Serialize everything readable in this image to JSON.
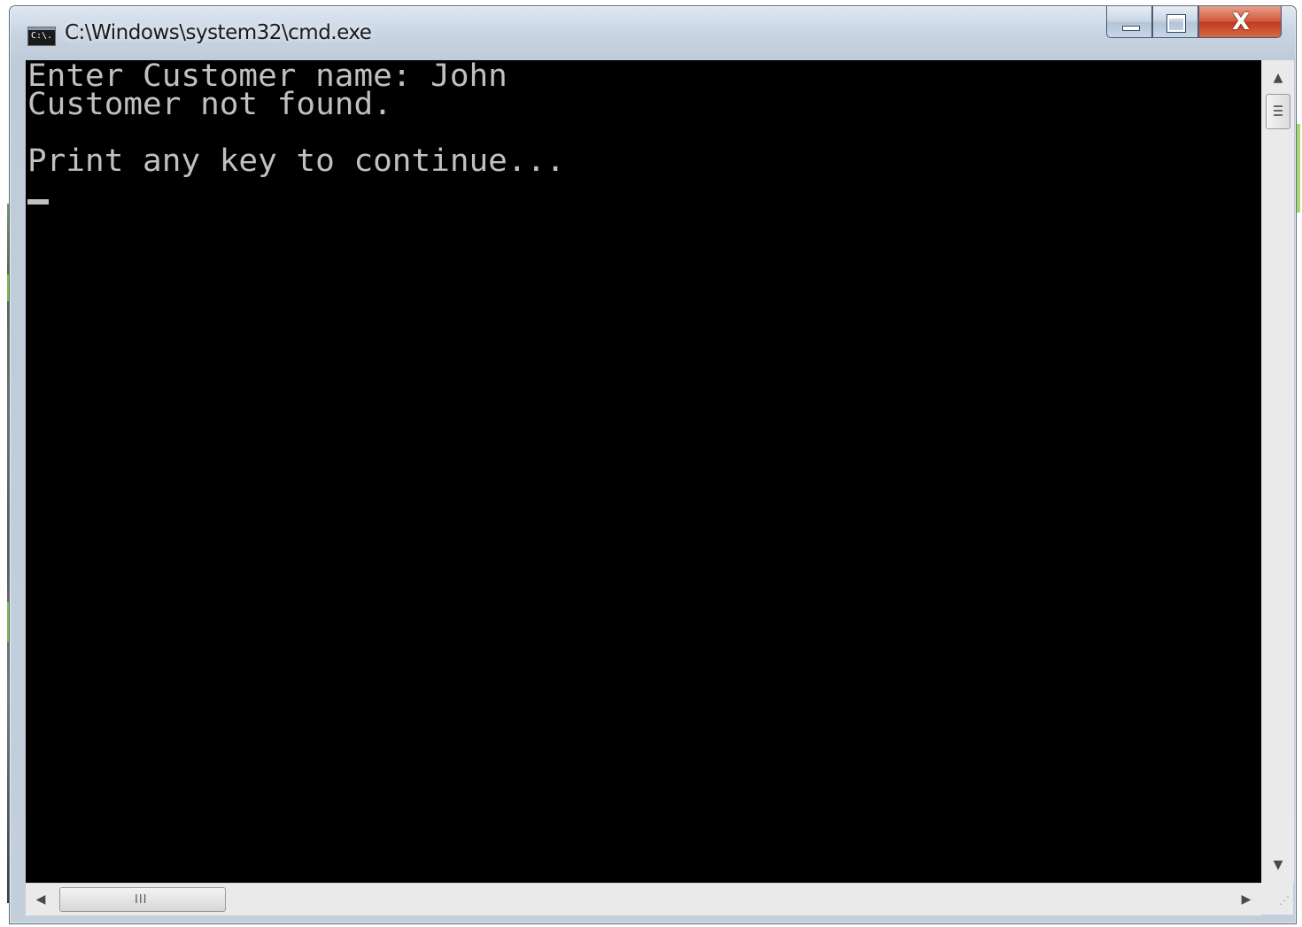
{
  "window": {
    "title": "C:\\Windows\\system32\\cmd.exe",
    "icon_name": "console-app-icon",
    "icon_text": "C:\\."
  },
  "caption_buttons": {
    "minimize_icon": "minimize-icon",
    "maximize_icon": "maximize-icon",
    "close_icon": "close-icon",
    "close_glyph": "X"
  },
  "console": {
    "background_color": "#000000",
    "text_color": "#c0c0c0",
    "lines": [
      "Enter Customer name: John",
      "Customer not found.",
      "Print any key to continue..."
    ]
  },
  "scrollbars": {
    "vertical": {
      "up_arrow": "▲",
      "down_arrow": "▼"
    },
    "horizontal": {
      "left_arrow": "◀",
      "right_arrow": "▶",
      "grip": "III"
    },
    "size_grip": "⋰"
  }
}
